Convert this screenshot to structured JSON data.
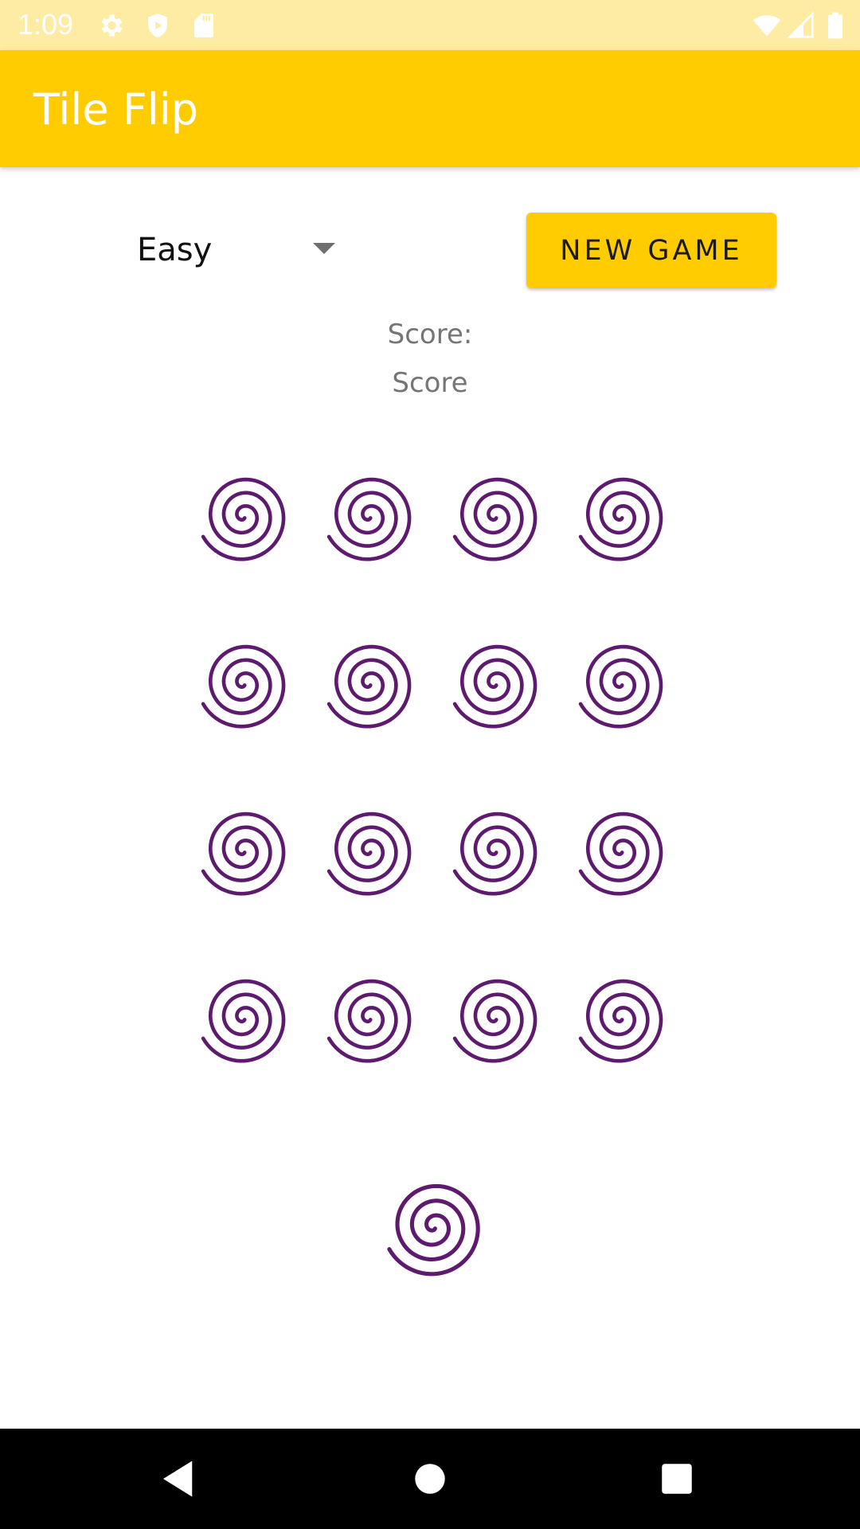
{
  "status_bar": {
    "time": "1:09",
    "icons": [
      "settings-icon",
      "play-protect-icon",
      "sd-card-icon",
      "wifi-icon",
      "signal-icon",
      "battery-icon"
    ]
  },
  "app_bar": {
    "title": "Tile Flip",
    "color": "#FFCC02"
  },
  "controls": {
    "difficulty_selected": "Easy",
    "new_game_label": "NEW GAME"
  },
  "score": {
    "label": "Score:",
    "value": "Score"
  },
  "board": {
    "rows": 4,
    "cols": 4,
    "tile_icon": "spiral-icon",
    "tile_color": "#5E1A6E",
    "tiles": [
      [
        "face-down",
        "face-down",
        "face-down",
        "face-down"
      ],
      [
        "face-down",
        "face-down",
        "face-down",
        "face-down"
      ],
      [
        "face-down",
        "face-down",
        "face-down",
        "face-down"
      ],
      [
        "face-down",
        "face-down",
        "face-down",
        "face-down"
      ]
    ]
  },
  "preview_tile": {
    "icon": "spiral-icon"
  },
  "nav_bar": {
    "buttons": [
      "back-icon",
      "home-icon",
      "recents-icon"
    ]
  }
}
